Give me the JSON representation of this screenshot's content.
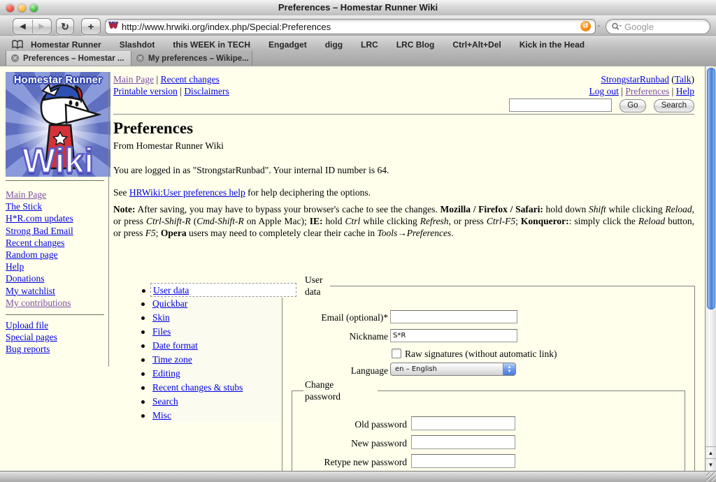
{
  "window": {
    "title": "Preferences – Homestar Runner Wiki"
  },
  "toolbar": {
    "url": "http://www.hrwiki.org/index.php/Special:Preferences",
    "search_placeholder": "Google",
    "back_glyph": "◀",
    "forward_glyph": "▶",
    "reload_glyph": "↻",
    "newtab_glyph": "+",
    "snapback_glyph": "↺"
  },
  "bookmarks": [
    "Homestar Runner",
    "Slashdot",
    "this WEEK in TECH",
    "Engadget",
    "digg",
    "LRC",
    "LRC Blog",
    "Ctrl+Alt+Del",
    "Kick in the Head"
  ],
  "tabs": [
    {
      "label": "Preferences – Homestar ...",
      "active": true
    },
    {
      "label": "My preferences – Wikipe...",
      "active": false
    }
  ],
  "logo": {
    "top_text": "Homestar Runner",
    "bottom_text": "Wiki"
  },
  "sidebar": {
    "nav": [
      {
        "label": "Main Page",
        "visited": true
      },
      {
        "label": "The Stick"
      },
      {
        "label": "H*R.com updates"
      },
      {
        "label": "Strong Bad Email"
      },
      {
        "label": "Recent changes"
      },
      {
        "label": "Random page"
      },
      {
        "label": "Help"
      },
      {
        "label": "Donations"
      },
      {
        "label": "My watchlist"
      },
      {
        "label": "My contributions",
        "visited": true
      }
    ],
    "tools": [
      {
        "label": "Upload file"
      },
      {
        "label": "Special pages"
      },
      {
        "label": "Bug reports"
      }
    ]
  },
  "header": {
    "top_links_1": [
      {
        "label": "Main Page",
        "visited": true
      },
      {
        "label": "Recent changes"
      }
    ],
    "top_links_2": [
      {
        "label": "Printable version"
      },
      {
        "label": "Disclaimers"
      }
    ],
    "username": "StrongstarRunbad",
    "talk_label": "Talk",
    "user_links": [
      {
        "label": "Log out"
      },
      {
        "label": "Preferences",
        "visited": true
      },
      {
        "label": "Help"
      }
    ],
    "go_label": "Go",
    "search_label": "Search"
  },
  "content": {
    "title": "Preferences",
    "subtitle": "From Homestar Runner Wiki",
    "logged_in": "You are logged in as \"StrongstarRunbad\". Your internal ID number is 64.",
    "see_prefix": "See ",
    "help_link": "HRWiki:User preferences help",
    "see_suffix": " for help deciphering the options.",
    "note_segments": [
      {
        "t": "Note:",
        "b": true
      },
      {
        "t": " After saving, you may have to bypass your browser's cache to see the changes. "
      },
      {
        "t": "Mozilla / Firefox / Safari:",
        "b": true
      },
      {
        "t": " hold down "
      },
      {
        "t": "Shift",
        "i": true
      },
      {
        "t": " while clicking "
      },
      {
        "t": "Reload",
        "i": true
      },
      {
        "t": ", or press "
      },
      {
        "t": "Ctrl-Shift-R",
        "i": true
      },
      {
        "t": " ("
      },
      {
        "t": "Cmd-Shift-R",
        "i": true
      },
      {
        "t": " on Apple Mac); "
      },
      {
        "t": "IE:",
        "b": true
      },
      {
        "t": " hold "
      },
      {
        "t": "Ctrl",
        "i": true
      },
      {
        "t": " while clicking "
      },
      {
        "t": "Refresh",
        "i": true
      },
      {
        "t": ", or press "
      },
      {
        "t": "Ctrl-F5",
        "i": true
      },
      {
        "t": "; "
      },
      {
        "t": "Konqueror:",
        "b": true
      },
      {
        "t": ": simply click the "
      },
      {
        "t": "Reload",
        "i": true
      },
      {
        "t": " button, or press "
      },
      {
        "t": "F5",
        "i": true
      },
      {
        "t": "; "
      },
      {
        "t": "Opera",
        "b": true
      },
      {
        "t": " users may need to completely clear their cache in "
      },
      {
        "t": "Tools→Preferences",
        "i": true
      },
      {
        "t": "."
      }
    ]
  },
  "pref_tabs": [
    {
      "label": "User data",
      "selected": true
    },
    {
      "label": "Quickbar"
    },
    {
      "label": "Skin"
    },
    {
      "label": "Files"
    },
    {
      "label": "Date format"
    },
    {
      "label": "Time zone"
    },
    {
      "label": "Editing"
    },
    {
      "label": "Recent changes & stubs"
    },
    {
      "label": "Search"
    },
    {
      "label": "Misc"
    }
  ],
  "form": {
    "legend_user_data": "User data",
    "email_label": "Email (optional)*",
    "email_value": "",
    "nickname_label": "Nickname",
    "nickname_value": "S*R",
    "raw_sig_label": "Raw signatures (without automatic link)",
    "raw_sig_checked": false,
    "language_label": "Language",
    "language_value": "en – English",
    "legend_change_password": "Change password",
    "old_password_label": "Old password",
    "new_password_label": "New password",
    "retype_password_label": "Retype new password"
  },
  "colors": {
    "page_background": "#FFFFEC",
    "link": "#0000E0",
    "visited_link": "#7A4FA3",
    "aqua_scrollbar": "#4a7bd9",
    "snapback_orange": "#f08308"
  }
}
